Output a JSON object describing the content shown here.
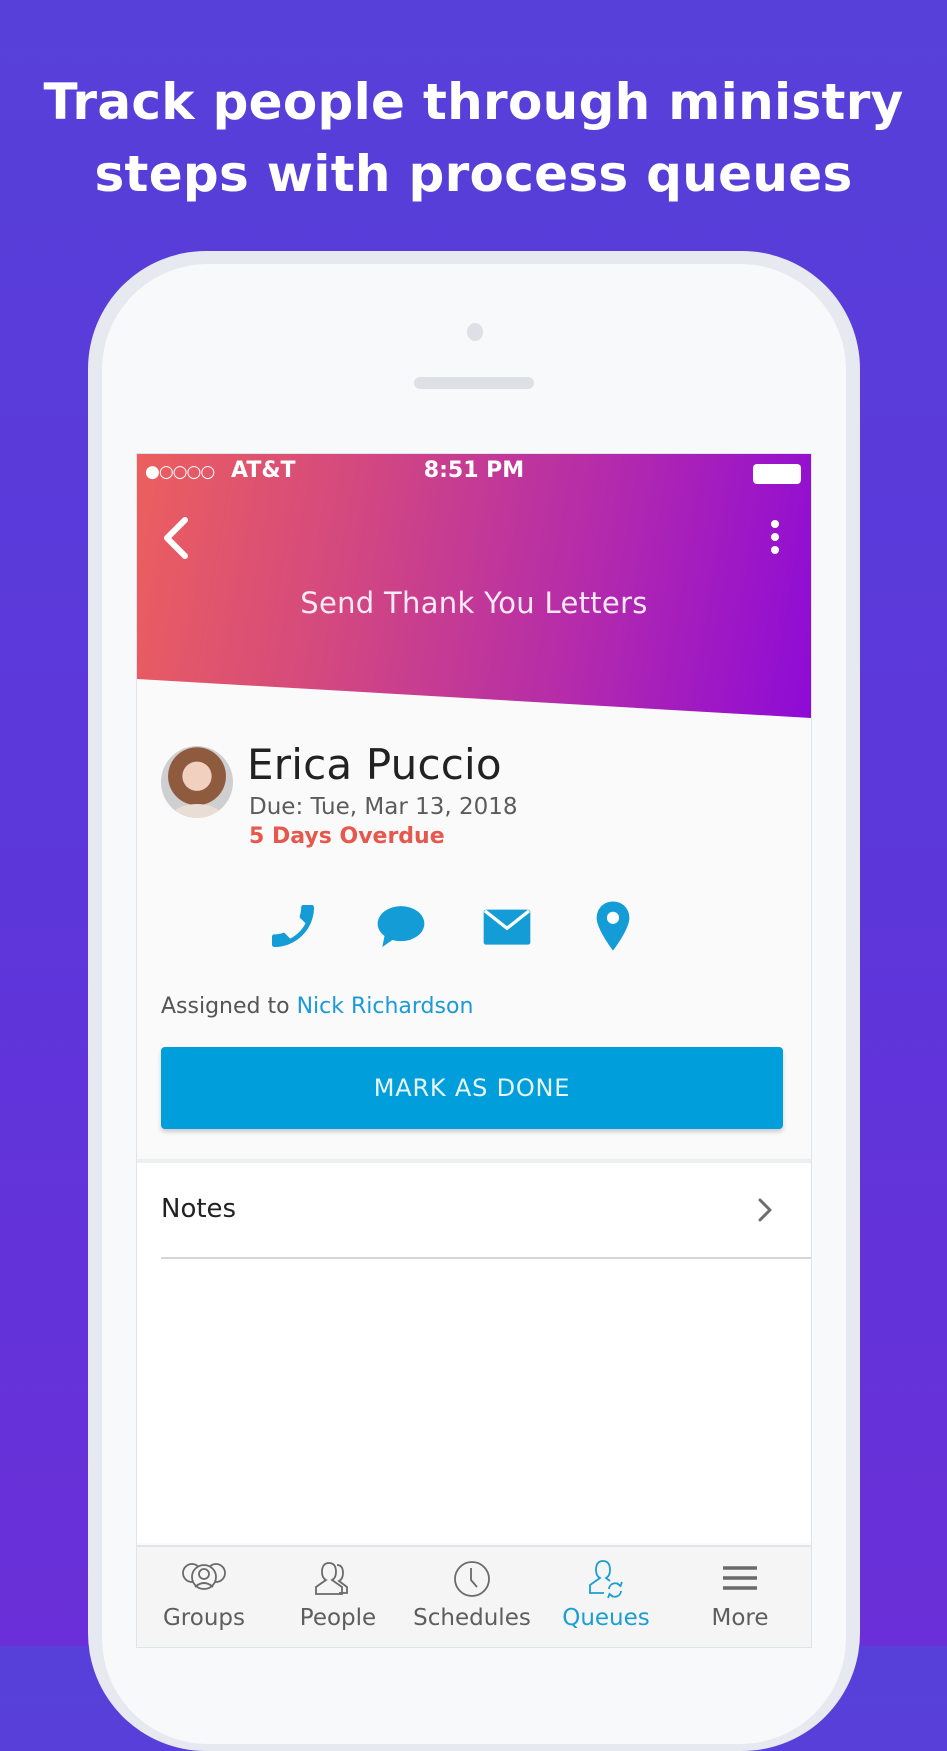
{
  "headline": {
    "line1": "Track people through ministry",
    "line2": "steps with process queues"
  },
  "status_bar": {
    "signal": "●○○○○",
    "carrier": "AT&T",
    "time": "8:51 PM"
  },
  "header": {
    "title": "Send Thank You Letters",
    "back_icon": "chevron-left-icon",
    "menu_icon": "more-vertical-icon",
    "gradient": [
      "#ec5f5e",
      "#d4497e",
      "#b42bab",
      "#8d0ad8"
    ]
  },
  "person": {
    "name": "Erica Puccio",
    "due": "Due: Tue, Mar 13, 2018",
    "overdue": "5 Days Overdue",
    "overdue_color": "#e6574d"
  },
  "actions": [
    {
      "name": "call",
      "icon": "phone-icon"
    },
    {
      "name": "message",
      "icon": "chat-bubble-icon"
    },
    {
      "name": "email",
      "icon": "envelope-icon"
    },
    {
      "name": "map",
      "icon": "map-pin-icon"
    }
  ],
  "assignment": {
    "prefix": "Assigned to",
    "assignee": "Nick Richardson"
  },
  "primary_button": {
    "label": "MARK AS DONE",
    "color": "#009fdb"
  },
  "notes": {
    "label": "Notes"
  },
  "tabbar": {
    "accent": "#1b9ed1",
    "items": [
      {
        "label": "Groups",
        "icon": "groups-icon",
        "active": false
      },
      {
        "label": "People",
        "icon": "people-icon",
        "active": false
      },
      {
        "label": "Schedules",
        "icon": "clock-icon",
        "active": false
      },
      {
        "label": "Queues",
        "icon": "queue-person-refresh-icon",
        "active": true
      },
      {
        "label": "More",
        "icon": "hamburger-menu-icon",
        "active": false
      }
    ]
  }
}
